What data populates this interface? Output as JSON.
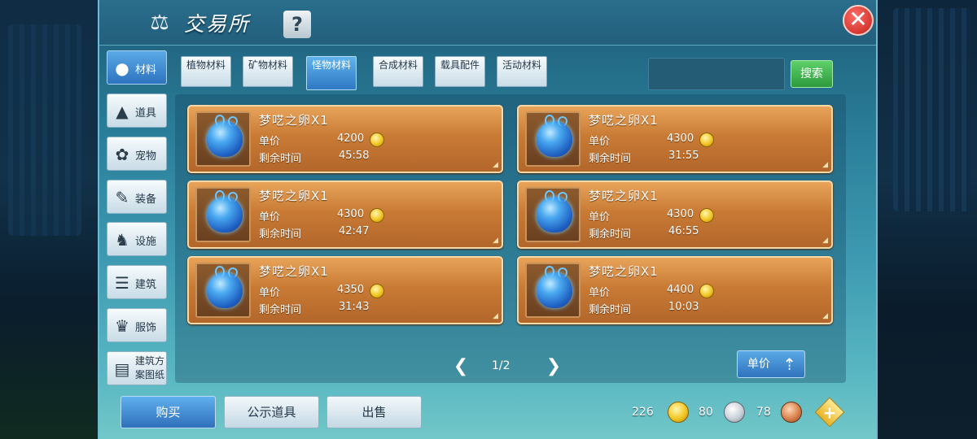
{
  "window": {
    "title": "交易所",
    "help_label": "?",
    "close_label": "✕"
  },
  "categories": [
    {
      "label": "材料",
      "icon": "materials-icon",
      "active": true
    },
    {
      "label": "道具",
      "icon": "flask-icon",
      "active": false
    },
    {
      "label": "宠物",
      "icon": "paw-icon",
      "active": false
    },
    {
      "label": "装备",
      "icon": "equipment-icon",
      "active": false
    },
    {
      "label": "设施",
      "icon": "facility-icon",
      "active": false
    },
    {
      "label": "建筑",
      "icon": "building-icon",
      "active": false
    },
    {
      "label": "服饰",
      "icon": "clothing-icon",
      "active": false
    },
    {
      "label": "建筑方案图纸",
      "icon": "blueprint-icon",
      "active": false
    }
  ],
  "subtabs": [
    {
      "label": "植物材料",
      "active": false
    },
    {
      "label": "矿物材料",
      "active": false
    },
    {
      "label": "怪物材料",
      "active": true
    },
    {
      "label": "合成材料",
      "active": false
    },
    {
      "label": "载具配件",
      "active": false
    },
    {
      "label": "活动材料",
      "active": false
    }
  ],
  "search": {
    "value": "",
    "button_label": "搜索"
  },
  "listings": [
    {
      "name": "梦呓之卵X1",
      "price_label": "单价",
      "price": "4200",
      "time_label": "剩余时间",
      "time": "45:58"
    },
    {
      "name": "梦呓之卵X1",
      "price_label": "单价",
      "price": "4300",
      "time_label": "剩余时间",
      "time": "31:55"
    },
    {
      "name": "梦呓之卵X1",
      "price_label": "单价",
      "price": "4300",
      "time_label": "剩余时间",
      "time": "42:47"
    },
    {
      "name": "梦呓之卵X1",
      "price_label": "单价",
      "price": "4300",
      "time_label": "剩余时间",
      "time": "46:55"
    },
    {
      "name": "梦呓之卵X1",
      "price_label": "单价",
      "price": "4350",
      "time_label": "剩余时间",
      "time": "31:43"
    },
    {
      "name": "梦呓之卵X1",
      "price_label": "单价",
      "price": "4400",
      "time_label": "剩余时间",
      "time": "10:03"
    }
  ],
  "pagination": {
    "page": "1/2"
  },
  "sort": {
    "label": "单价"
  },
  "actions": {
    "buy": "购买",
    "show": "公示道具",
    "sell": "出售"
  },
  "currency": {
    "gold": "226",
    "silver": "80",
    "copper": "78",
    "add_label": "+"
  },
  "colors": {
    "panel_blue": "#2a7d98",
    "active_tab": "#2f78c4",
    "card_orange": "#c97b35",
    "search_green": "#2c9a3c",
    "close_red": "#c1201a"
  }
}
